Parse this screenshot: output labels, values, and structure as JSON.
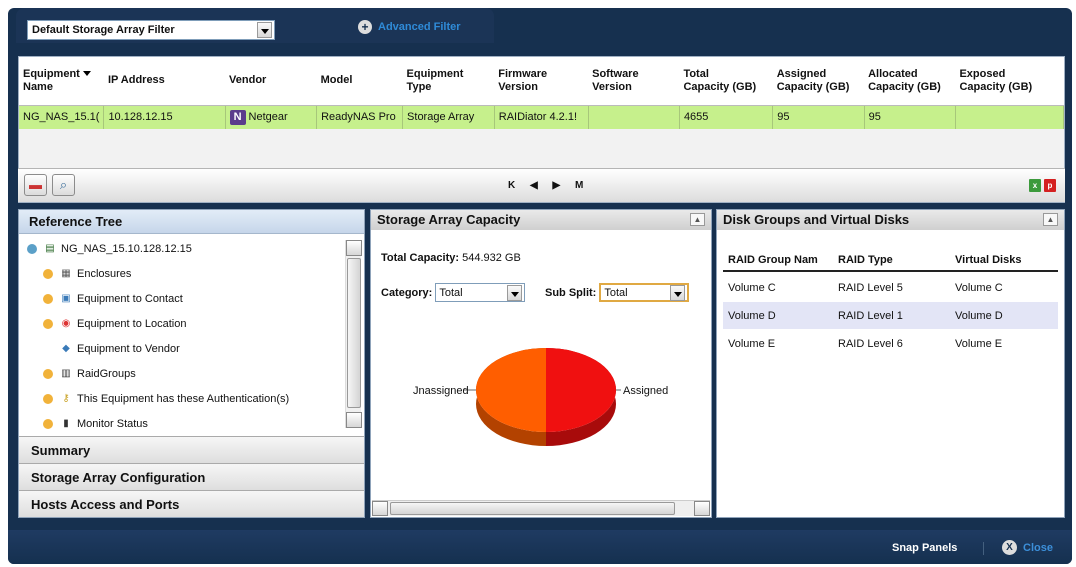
{
  "filter": {
    "selected": "Default Storage Array Filter",
    "advanced_label": "Advanced Filter"
  },
  "equipment_table": {
    "headers": [
      "Equipment Name",
      "IP Address",
      "Vendor",
      "Model",
      "Equipment Type",
      "Firmware Version",
      "Software Version",
      "Total Capacity (GB)",
      "Assigned Capacity (GB)",
      "Allocated Capacity (GB)",
      "Exposed Capacity (GB)"
    ],
    "header_lines": [
      [
        "Equipment",
        "Name"
      ],
      [
        "IP Address"
      ],
      [
        "Vendor"
      ],
      [
        "Model"
      ],
      [
        "Equipment",
        "Type"
      ],
      [
        "Firmware",
        "Version"
      ],
      [
        "Software",
        "Version"
      ],
      [
        "Total",
        "Capacity (GB)"
      ],
      [
        "Assigned",
        "Capacity (GB)"
      ],
      [
        "Allocated",
        "Capacity (GB)"
      ],
      [
        "Exposed",
        "Capacity (GB)"
      ]
    ],
    "rows": [
      [
        "NG_NAS_15.1(",
        "10.128.12.15",
        "Netgear",
        "ReadyNAS Pro",
        "Storage Array",
        "RAIDiator 4.2.1!",
        "",
        "4655",
        "95",
        "95",
        ""
      ]
    ],
    "row_color": "#c6f08c",
    "vendor_logo_letter": "N",
    "pager": "K ◀ ▶ M"
  },
  "reference_tree": {
    "title": "Reference Tree",
    "nodes": [
      {
        "label": "NG_NAS_15.10.128.12.15",
        "icon": "storage-device-icon"
      },
      {
        "label": "Enclosures",
        "icon": "enclosure-icon"
      },
      {
        "label": "Equipment to Contact",
        "icon": "contact-icon"
      },
      {
        "label": "Equipment to Location",
        "icon": "location-icon"
      },
      {
        "label": "Equipment to Vendor",
        "icon": "vendor-icon"
      },
      {
        "label": "RaidGroups",
        "icon": "raid-group-icon"
      },
      {
        "label": "This Equipment has these Authentication(s)",
        "icon": "key-icon"
      },
      {
        "label": "Monitor Status",
        "icon": "monitor-icon"
      }
    ],
    "sections": [
      "Summary",
      "Storage Array Configuration",
      "Hosts Access and Ports"
    ]
  },
  "capacity": {
    "title": "Storage Array Capacity",
    "total_label": "Total Capacity:",
    "total_value": "544.932 GB",
    "category_label": "Category:",
    "category_value": "Total",
    "subsplit_label": "Sub Split:",
    "subsplit_value": "Total",
    "chart_data": {
      "type": "pie",
      "labels": [
        "Unassigned",
        "Assigned"
      ],
      "visible_labels": [
        "Jnassigned",
        "Assigned"
      ],
      "values": [
        50,
        50
      ],
      "colors": [
        "#ff5e00",
        "#f01010"
      ]
    }
  },
  "disk_groups": {
    "title": "Disk Groups and Virtual Disks",
    "headers": [
      "RAID Group Name",
      "RAID Type",
      "Virtual Disks"
    ],
    "header_visible": [
      "RAID Group Nam",
      "RAID Type",
      "Virtual Disks"
    ],
    "rows": [
      [
        "Volume C",
        "RAID Level 5",
        "Volume C"
      ],
      [
        "Volume D",
        "RAID Level 1",
        "Volume D"
      ],
      [
        "Volume E",
        "RAID Level 6",
        "Volume E"
      ]
    ],
    "selected_row": 1
  },
  "footer": {
    "snap_label": "Snap Panels",
    "close_label": "Close"
  }
}
